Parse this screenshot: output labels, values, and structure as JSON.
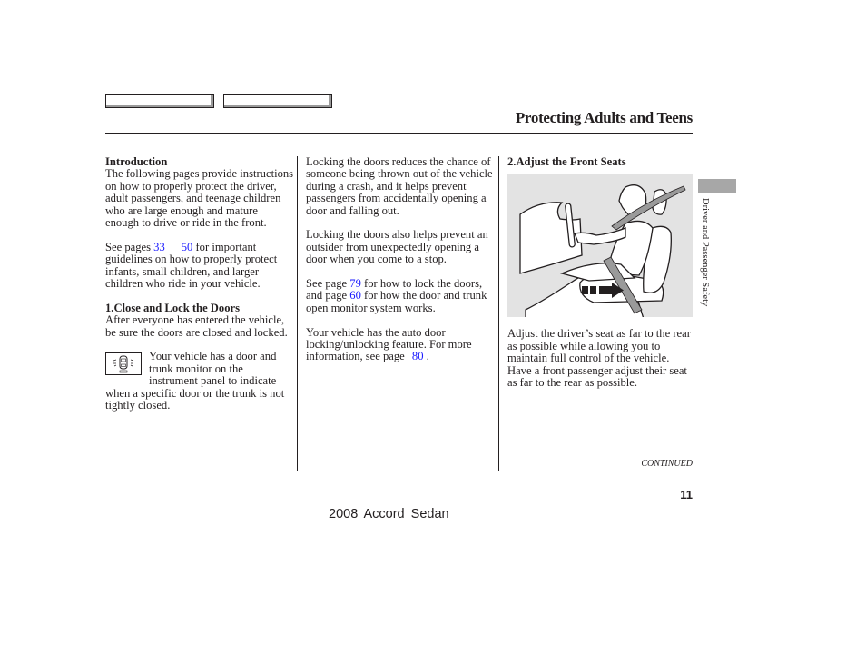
{
  "header": {
    "title": "Protecting Adults and Teens"
  },
  "column1": {
    "intro_heading": "Introduction",
    "intro_text": "The following pages provide instructions on how to properly protect the driver, adult passengers, and teenage children who are large enough and mature enough to drive or ride in the front.",
    "see_pages_prefix": "See pages ",
    "see_pages_link1": "33",
    "see_pages_link2": "50",
    "see_pages_suffix": " for important guidelines on how to properly protect infants, small children, and larger children who ride in your vehicle.",
    "section1_heading": "1.Close and Lock the Doors",
    "section1_text": "After everyone has entered the vehicle, be sure the doors are closed and locked.",
    "monitor_icon": "door-trunk-monitor-icon",
    "monitor_text": "Your vehicle has a door and trunk monitor on the instrument panel to indicate when a specific door or the trunk is not tightly closed."
  },
  "column2": {
    "para1": "Locking the doors reduces the chance of someone being thrown out of the vehicle during a crash, and it helps prevent passengers from accidentally opening a door and falling out.",
    "para2": "Locking the doors also helps prevent an outsider from unexpectedly opening a door when you come to a stop.",
    "para3_prefix": "See page ",
    "para3_link1": "79",
    "para3_mid": " for how to lock the doors, and page ",
    "para3_link2": "60",
    "para3_suffix": " for how the door and trunk open monitor system works.",
    "para4_prefix": "Your vehicle has the auto door locking/unlocking feature. For more information, see page ",
    "para4_link": "80",
    "para4_suffix": " ."
  },
  "column3": {
    "section2_heading": "2.Adjust the Front Seats",
    "figure": "driver-seat-adjustment-illustration",
    "section2_text": "Adjust the driver’s seat as far to the rear as possible while allowing you to maintain full control of the vehicle. Have a front passenger adjust their seat as far to the rear as possible."
  },
  "side_tab": {
    "label": "Driver and Passenger Safety"
  },
  "footer": {
    "continued": "CONTINUED",
    "page_number": "11",
    "model": "2008  Accord  Sedan"
  },
  "colors": {
    "link": "#1a1aff",
    "text": "#231f20",
    "figure_bg": "#e3e3e3",
    "tab": "#a7a7a7"
  }
}
